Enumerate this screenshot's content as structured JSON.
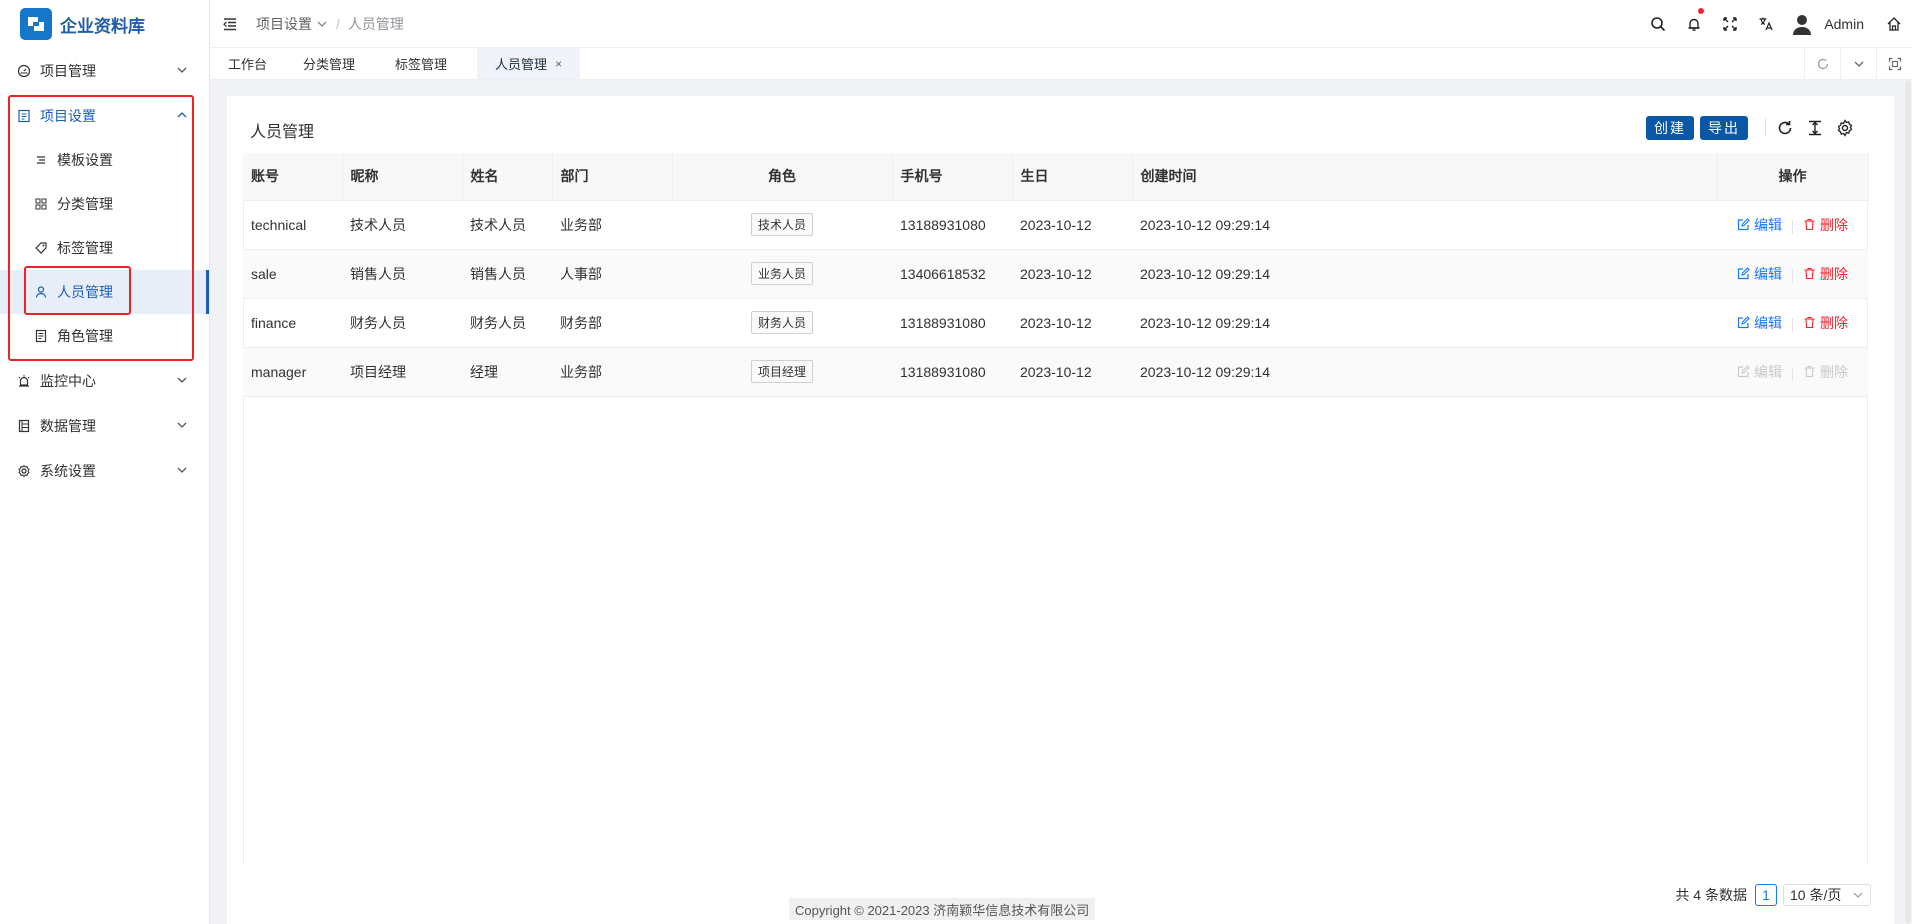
{
  "app": {
    "title": "企业资料库"
  },
  "sidebar": {
    "groups": [
      {
        "label": "项目管理",
        "icon": "dashboard-icon"
      },
      {
        "label": "项目设置",
        "icon": "document-icon",
        "expanded": true
      },
      {
        "label": "监控中心",
        "icon": "alarm-icon"
      },
      {
        "label": "数据管理",
        "icon": "book-icon"
      },
      {
        "label": "系统设置",
        "icon": "gear-icon"
      }
    ],
    "sub_items": [
      {
        "label": "模板设置",
        "icon": "list-icon"
      },
      {
        "label": "分类管理",
        "icon": "grid-icon"
      },
      {
        "label": "标签管理",
        "icon": "tag-icon"
      },
      {
        "label": "人员管理",
        "icon": "user-icon",
        "selected": true
      },
      {
        "label": "角色管理",
        "icon": "receipt-icon"
      }
    ]
  },
  "header": {
    "breadcrumb": [
      "项目设置",
      "人员管理"
    ],
    "username": "Admin"
  },
  "tabs": [
    {
      "label": "工作台"
    },
    {
      "label": "分类管理"
    },
    {
      "label": "标签管理"
    },
    {
      "label": "人员管理",
      "active": true,
      "close": "×"
    }
  ],
  "page": {
    "title": "人员管理",
    "create_label": "创建",
    "export_label": "导出"
  },
  "table": {
    "columns": [
      "账号",
      "昵称",
      "姓名",
      "部门",
      "角色",
      "手机号",
      "生日",
      "创建时间",
      "操作"
    ],
    "rows": [
      {
        "account": "technical",
        "nickname": "技术人员",
        "name": "技术人员",
        "dept": "业务部",
        "role": "技术人员",
        "phone": "13188931080",
        "birthday": "2023-10-12",
        "created": "2023-10-12 09:29:14"
      },
      {
        "account": "sale",
        "nickname": "销售人员",
        "name": "销售人员",
        "dept": "人事部",
        "role": "业务人员",
        "phone": "13406618532",
        "birthday": "2023-10-12",
        "created": "2023-10-12 09:29:14"
      },
      {
        "account": "finance",
        "nickname": "财务人员",
        "name": "财务人员",
        "dept": "财务部",
        "role": "财务人员",
        "phone": "13188931080",
        "birthday": "2023-10-12",
        "created": "2023-10-12 09:29:14"
      },
      {
        "account": "manager",
        "nickname": "项目经理",
        "name": "经理",
        "dept": "业务部",
        "role": "项目经理",
        "phone": "13188931080",
        "birthday": "2023-10-12",
        "created": "2023-10-12 09:29:14"
      }
    ],
    "edit_label": "编辑",
    "delete_label": "删除"
  },
  "pagination": {
    "total_text": "共 4 条数据",
    "current_page": "1",
    "page_size": "10 条/页"
  },
  "footer": {
    "copyright": "Copyright © 2021-2023 济南颖华信息技术有限公司"
  },
  "colors": {
    "primary": "#0b57a8",
    "highlight": "#e8262a",
    "edit": "#1677ff",
    "delete": "#f5222d"
  }
}
